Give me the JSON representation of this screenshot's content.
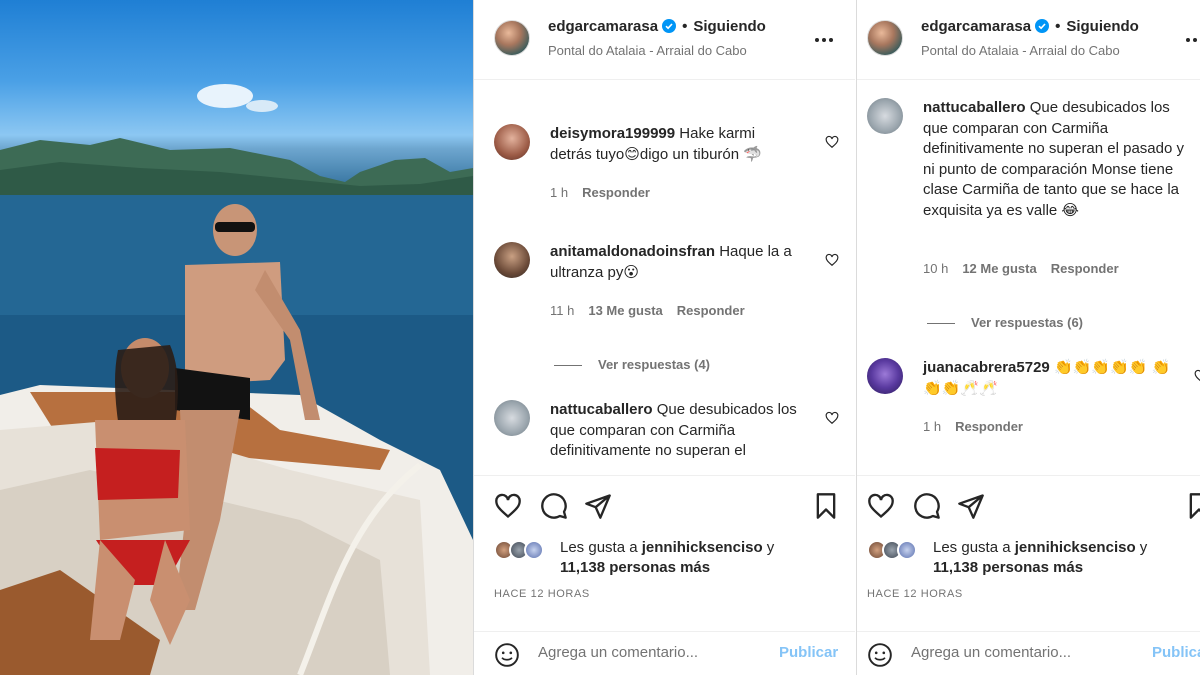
{
  "post": {
    "username": "edgarcamarasa",
    "separator": "•",
    "following_label": "Siguiendo",
    "location": "Pontal do Atalaia - Arraial do Cabo",
    "more_label": "•••"
  },
  "panel1": {
    "comments": [
      {
        "user": "deisymora199999",
        "text": "Hake karmi detrás tuyo😊digo un tiburón 🦈",
        "time": "1 h",
        "likes": "",
        "reply": "Responder"
      },
      {
        "user": "anitamaldonadoinsfran",
        "text": "Haque la a ultranza py😮",
        "time": "11 h",
        "likes": "13 Me gusta",
        "reply": "Responder"
      },
      {
        "user": "nattucaballero",
        "text": "Que desubicados los que comparan con Carmiña definitivamente no superan el",
        "time": "",
        "likes": "",
        "reply": ""
      }
    ],
    "view_replies": "Ver respuestas (4)"
  },
  "panel2": {
    "comments": [
      {
        "user": "nattucaballero",
        "text": "Que desubicados los que comparan con Carmiña definitivamente no superan el pasado y ni punto de comparación Monse tiene clase Carmiña de tanto que se hace la exquisita ya es valle 😂",
        "time": "10 h",
        "likes": "12 Me gusta",
        "reply": "Responder"
      },
      {
        "user": "juanacabrera5729",
        "text": "👏👏👏👏👏 👏👏👏🥂🥂",
        "time": "1 h",
        "likes": "",
        "reply": "Responder"
      }
    ],
    "view_replies": "Ver respuestas (6)"
  },
  "footer": {
    "likes_prefix": "Les gusta a",
    "likes_user": "jennihicksenciso",
    "likes_conj": "y",
    "likes_count": "11,138 personas más",
    "time_ago": "HACE 12 HORAS",
    "comment_placeholder": "Agrega un comentario...",
    "publish_label": "Publicar"
  },
  "colors": {
    "verified": "#0095f6",
    "publish": "#85c4f7",
    "text": "#262626",
    "muted": "#737373"
  },
  "icons": [
    "heart-icon",
    "comment-icon",
    "share-icon",
    "bookmark-icon",
    "emoji-icon",
    "verified-icon",
    "more-icon"
  ]
}
